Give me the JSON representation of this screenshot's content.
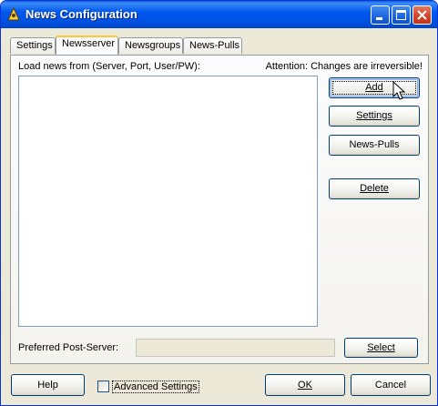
{
  "window": {
    "title": "News Configuration"
  },
  "tabs": [
    {
      "label": "Settings"
    },
    {
      "label": "Newsserver"
    },
    {
      "label": "Newsgroups"
    },
    {
      "label": "News-Pulls"
    }
  ],
  "active_tab": "Newsserver",
  "panel": {
    "list_label": "Load news from (Server, Port, User/PW):",
    "warning": "Attention: Changes are irreversible!",
    "buttons": {
      "add": "Add",
      "settings": "Settings",
      "news_pulls": "News-Pulls",
      "delete": "Delete"
    },
    "post_server_label": "Preferred Post-Server:",
    "post_server_value": "",
    "select_button": "Select"
  },
  "footer": {
    "help": "Help",
    "advanced_settings": "Advanced Settings",
    "advanced_checked": false,
    "ok": "OK",
    "cancel": "Cancel"
  },
  "icons": {
    "app": "news-config-icon",
    "minimize": "minimize-icon",
    "maximize": "maximize-icon",
    "close": "close-icon",
    "cursor": "mouse-pointer-icon"
  },
  "colors": {
    "titlebar": "#0058ee",
    "dialog_bg": "#ece9d8",
    "tab_highlight": "#ffc83c",
    "close_button": "#d3452a"
  }
}
